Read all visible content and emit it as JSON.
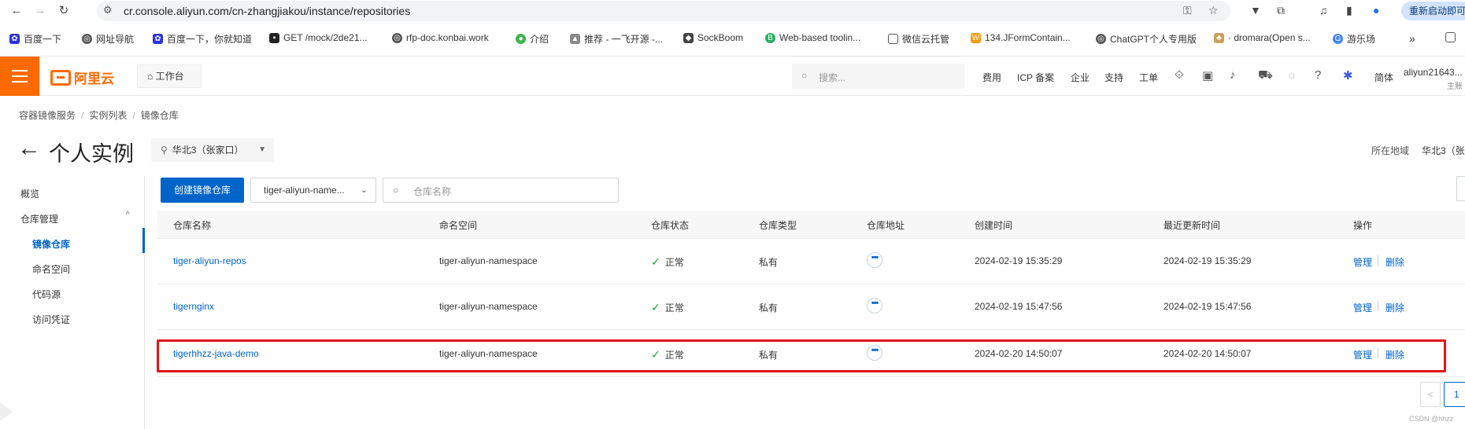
{
  "browser": {
    "url": "cr.console.aliyun.com/cn-zhangjiakou/instance/repositories",
    "relaunch_label": "重新启动即可",
    "bookmarks": [
      "百度一下",
      "网址导航",
      "百度一下，你就知道",
      "GET /mock/2de21...",
      "rfp-doc.konbai.work",
      "介绍",
      "推荐 - 一飞开源 -...",
      "SockBoom",
      "Web-based toolin...",
      "微信云托管",
      "134.JFormContain...",
      "ChatGPT个人专用版",
      "· dromara(Open s...",
      "游乐场"
    ],
    "bookmarks_more": "»"
  },
  "topbar": {
    "logo": "阿里云",
    "workbench": "工作台",
    "search_placeholder": "搜索...",
    "nav": [
      "费用",
      "ICP 备案",
      "企业",
      "支持",
      "工单"
    ],
    "lang": "简体",
    "user": "aliyun21643...",
    "user_sub": "主账"
  },
  "breadcrumb": [
    "容器镜像服务",
    "实例列表",
    "镜像仓库"
  ],
  "header": {
    "title": "个人实例",
    "region": "华北3（张家口）",
    "region_label": "所在地域",
    "region_value": "华北3（张"
  },
  "sidebar": {
    "overview": "概览",
    "repo_mgmt": "仓库管理",
    "items": [
      "镜像仓库",
      "命名空间",
      "代码源",
      "访问凭证"
    ]
  },
  "toolbar": {
    "create_label": "创建镜像仓库",
    "namespace_value": "tiger-aliyun-name...",
    "search_placeholder": "仓库名称"
  },
  "table": {
    "columns": [
      "仓库名称",
      "命名空间",
      "仓库状态",
      "仓库类型",
      "仓库地址",
      "创建时间",
      "最近更新时间",
      "操作"
    ],
    "rows": [
      {
        "name": "tiger-aliyun-repos",
        "namespace": "tiger-aliyun-namespace",
        "status": "正常",
        "type": "私有",
        "created": "2024-02-19 15:35:29",
        "updated": "2024-02-19 15:35:29",
        "manage": "管理",
        "delete": "删除"
      },
      {
        "name": "tigernginx",
        "namespace": "tiger-aliyun-namespace",
        "status": "正常",
        "type": "私有",
        "created": "2024-02-19 15:47:56",
        "updated": "2024-02-19 15:47:56",
        "manage": "管理",
        "delete": "删除"
      },
      {
        "name": "tigerhhzz-java-demo",
        "namespace": "tiger-aliyun-namespace",
        "status": "正常",
        "type": "私有",
        "created": "2024-02-20 14:50:07",
        "updated": "2024-02-20 14:50:07",
        "manage": "管理",
        "delete": "删除"
      }
    ]
  },
  "pagination": {
    "current": "1"
  },
  "watermark": "CSDN @hhzz",
  "colors": {
    "accent": "#0064c8",
    "brand": "#ff6a00",
    "highlight": "#e31414",
    "success": "#16a34a"
  }
}
